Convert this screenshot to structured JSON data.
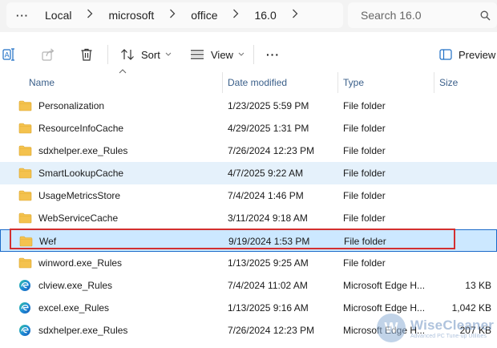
{
  "address_bar": {
    "more_label": "···",
    "crumbs": [
      "Local",
      "microsoft",
      "office",
      "16.0"
    ],
    "search_placeholder": "Search 16.0"
  },
  "toolbar": {
    "sort_label": "Sort",
    "view_label": "View",
    "more_label": "···",
    "preview_label": "Preview"
  },
  "columns": {
    "name": "Name",
    "date": "Date modified",
    "type": "Type",
    "size": "Size"
  },
  "rows": [
    {
      "name": "Personalization",
      "date": "1/23/2025 5:59 PM",
      "type": "File folder",
      "size": "",
      "icon": "folder-icon"
    },
    {
      "name": "ResourceInfoCache",
      "date": "4/29/2025 1:31 PM",
      "type": "File folder",
      "size": "",
      "icon": "folder-icon"
    },
    {
      "name": "sdxhelper.exe_Rules",
      "date": "7/26/2024 12:23 PM",
      "type": "File folder",
      "size": "",
      "icon": "folder-icon"
    },
    {
      "name": "SmartLookupCache",
      "date": "4/7/2025 9:22 AM",
      "type": "File folder",
      "size": "",
      "icon": "folder-icon"
    },
    {
      "name": "UsageMetricsStore",
      "date": "7/4/2024 1:46 PM",
      "type": "File folder",
      "size": "",
      "icon": "folder-icon"
    },
    {
      "name": "WebServiceCache",
      "date": "3/11/2024 9:18 AM",
      "type": "File folder",
      "size": "",
      "icon": "folder-icon"
    },
    {
      "name": "Wef",
      "date": "9/19/2024 1:53 PM",
      "type": "File folder",
      "size": "",
      "icon": "folder-icon"
    },
    {
      "name": "winword.exe_Rules",
      "date": "1/13/2025 9:25 AM",
      "type": "File folder",
      "size": "",
      "icon": "folder-icon"
    },
    {
      "name": "clview.exe_Rules",
      "date": "7/4/2024 11:02 AM",
      "type": "Microsoft Edge H...",
      "size": "13 KB",
      "icon": "edge-icon"
    },
    {
      "name": "excel.exe_Rules",
      "date": "1/13/2025 9:16 AM",
      "type": "Microsoft Edge H...",
      "size": "1,042 KB",
      "icon": "edge-icon"
    },
    {
      "name": "sdxhelper.exe_Rules",
      "date": "7/26/2024 12:23 PM",
      "type": "Microsoft Edge H...",
      "size": "207 KB",
      "icon": "edge-icon"
    }
  ],
  "watermark": {
    "letter": "W",
    "brand": "WiseCleaner",
    "tagline": "Advanced PC Tune-up Utilities"
  },
  "colors": {
    "selection_bg": "#cce8ff",
    "hover_bg": "#e5f1fb",
    "highlight_box": "#d32f2f",
    "folder": "#f4c24e",
    "column_header_text": "#3a5f8a"
  }
}
